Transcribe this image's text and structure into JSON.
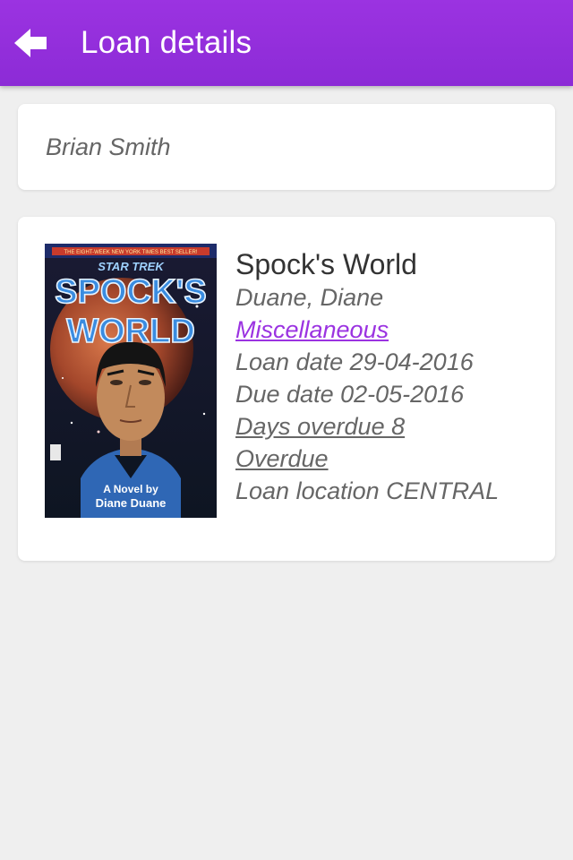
{
  "header": {
    "title": "Loan details",
    "back_icon": "back-arrow-icon",
    "colors": {
      "bar": "#9b33e1",
      "text": "#ffffff"
    }
  },
  "patron": {
    "name": "Brian Smith"
  },
  "loan": {
    "cover": {
      "tagline": "THE EIGHT-WEEK NEW YORK TIMES BEST SELLER!",
      "series": "STAR TREK",
      "title_line1": "SPOCK'S",
      "title_line2": "WORLD",
      "byline1": "A Novel by",
      "byline2": "Diane Duane"
    },
    "title": "Spock's World",
    "author": "Duane, Diane",
    "category": "Miscellaneous",
    "loan_date": "Loan date 29-04-2016",
    "due_date": "Due date 02-05-2016",
    "days_overdue": "Days overdue 8",
    "status": "Overdue",
    "location": "Loan location CENTRAL",
    "colors": {
      "category": "#9b33e1",
      "text": "#666666",
      "title": "#333333"
    }
  }
}
